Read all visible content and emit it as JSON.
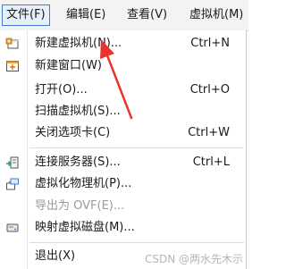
{
  "menubar": {
    "items": [
      {
        "label": "文件(F)"
      },
      {
        "label": "编辑(E)"
      },
      {
        "label": "查看(V)"
      },
      {
        "label": "虚拟机(M)"
      }
    ]
  },
  "menu": {
    "items": [
      {
        "label": "新建虚拟机(N)...",
        "shortcut": "Ctrl+N",
        "icon": "new-vm-icon"
      },
      {
        "label": "新建窗口(W)",
        "shortcut": "",
        "icon": "new-window-icon"
      },
      {
        "label": "打开(O)...",
        "shortcut": "Ctrl+O",
        "icon": ""
      },
      {
        "label": "扫描虚拟机(S)...",
        "shortcut": "",
        "icon": ""
      },
      {
        "label": "关闭选项卡(C)",
        "shortcut": "Ctrl+W",
        "icon": ""
      },
      {
        "label": "连接服务器(S)...",
        "shortcut": "Ctrl+L",
        "icon": "connect-server-icon"
      },
      {
        "label": "虚拟化物理机(P)...",
        "shortcut": "",
        "icon": "virtualize-physical-icon"
      },
      {
        "label": "导出为 OVF(E)...",
        "shortcut": "",
        "icon": "",
        "disabled": true
      },
      {
        "label": "映射虚拟磁盘(M)...",
        "shortcut": "",
        "icon": "map-disk-icon"
      },
      {
        "label": "退出(X)",
        "shortcut": "",
        "icon": ""
      }
    ]
  },
  "annotation": {
    "color": "#e8352b"
  },
  "watermark": "CSDN @两水先木示"
}
